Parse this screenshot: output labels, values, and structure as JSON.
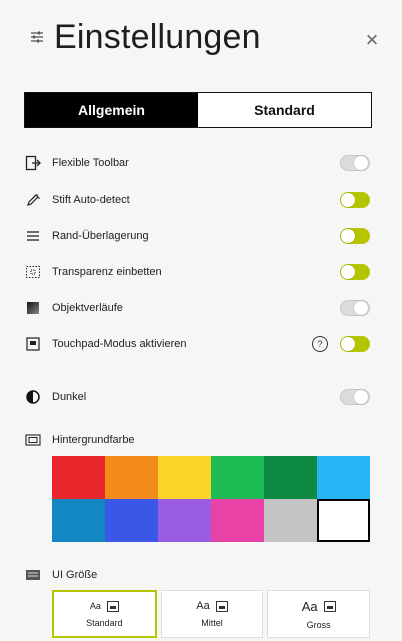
{
  "header": {
    "title": "Einstellungen",
    "close_glyph": "×"
  },
  "tabs": [
    {
      "label": "Allgemein",
      "active": true
    },
    {
      "label": "Standard",
      "active": false
    }
  ],
  "settings": [
    {
      "icon": "flexible-toolbar-icon",
      "label": "Flexible Toolbar",
      "enabled": false
    },
    {
      "icon": "pen-icon",
      "label": "Stift Auto-detect",
      "enabled": true
    },
    {
      "icon": "menu-lines-icon",
      "label": "Rand-Überlagerung",
      "enabled": true
    },
    {
      "icon": "dotted-square-icon",
      "label": "Transparenz einbetten",
      "enabled": true
    },
    {
      "icon": "gradient-square-icon",
      "label": "Objektverläufe",
      "enabled": false
    },
    {
      "icon": "touchpad-icon",
      "label": "Touchpad-Modus aktivieren",
      "enabled": true,
      "help": "?"
    },
    {
      "icon": "contrast-icon",
      "label": "Dunkel",
      "enabled": false
    }
  ],
  "background": {
    "label": "Hintergrundfarbe",
    "colors": [
      "#e8262b",
      "#f28a1c",
      "#fdd42a",
      "#1fbc55",
      "#0f8a42",
      "#27b6f5",
      "#1287c2",
      "#3a57e8",
      "#9a5ce0",
      "#e842a6",
      "#c4c4c6",
      "#ffffff"
    ],
    "selected_index": 11
  },
  "ui_size": {
    "label": "UI Größe",
    "sample": "Aa",
    "options": [
      {
        "label": "Standard",
        "active": true
      },
      {
        "label": "Mittel",
        "active": false
      },
      {
        "label": "Gross",
        "active": false
      }
    ]
  },
  "accent_color": "#b7c400"
}
